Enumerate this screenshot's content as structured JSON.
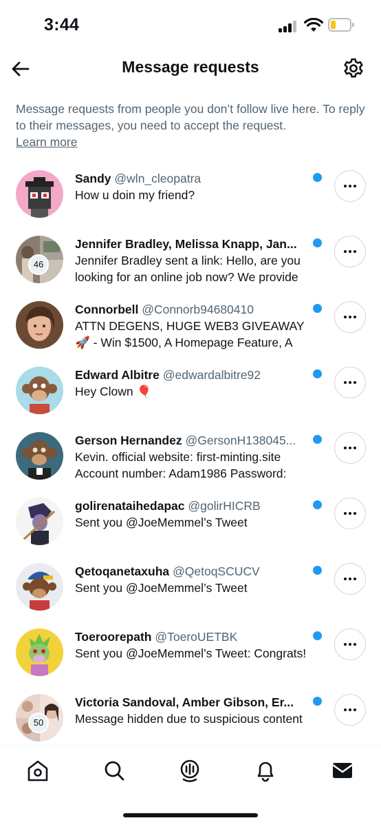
{
  "status_bar": {
    "time": "3:44",
    "battery_level": 0.25
  },
  "header": {
    "title": "Message requests"
  },
  "info": {
    "text": "Message requests from people you don’t follow live here. To reply to their messages, you need to accept the request.",
    "link": "Learn more"
  },
  "requests": [
    {
      "name": "Sandy",
      "handle": "@wln_cleopatra",
      "message": "How u doin my friend?",
      "message2": "",
      "unread": true
    },
    {
      "name": "Jennifer Bradley, Melissa Knapp, Jan...",
      "handle": "",
      "message": "Jennifer Bradley sent a link: Hello, are you",
      "message2": "looking for an online job now? We provide",
      "badge": "46",
      "unread": true
    },
    {
      "name": "Connorbell",
      "handle": "@Connorb94680410",
      "message": "ATTN DEGENS, HUGE WEB3 GIVEAWAY",
      "message2": "🚀 - Win $1500, A Homepage Feature, A",
      "unread": true
    },
    {
      "name": "Edward Albitre",
      "handle": "@edwardalbitre92",
      "message": "Hey Clown 🎈",
      "message2": "",
      "unread": true
    },
    {
      "name": "Gerson Hernandez",
      "handle": "@GersonH138045...",
      "message": "Kevin. official website: first-minting.site",
      "message2": "Account number: Adam1986 Password:",
      "unread": true
    },
    {
      "name": "golirenataihedapac",
      "handle": "@golirHICRB",
      "message": "Sent you @JoeMemmel’s Tweet",
      "message2": "",
      "unread": true
    },
    {
      "name": "Qetoqanetaxuha",
      "handle": "@QetoqSCUCV",
      "message": "Sent you @JoeMemmel’s Tweet",
      "message2": "",
      "unread": true
    },
    {
      "name": "Toeroorepath",
      "handle": "@ToeroUETBK",
      "message": "Sent you @JoeMemmel’s Tweet: Congrats!",
      "message2": "",
      "unread": true
    },
    {
      "name": "Victoria Sandoval, Amber Gibson, Er...",
      "handle": "",
      "message": "Message hidden due to suspicious content",
      "message2": "",
      "badge": "50",
      "unread": true
    }
  ],
  "tabs": [
    {
      "icon": "home-icon"
    },
    {
      "icon": "search-icon"
    },
    {
      "icon": "spaces-icon"
    },
    {
      "icon": "notifications-icon"
    },
    {
      "icon": "messages-icon"
    }
  ],
  "colors": {
    "accent": "#1d9bf0",
    "text": "#0f1419",
    "muted": "#536471"
  }
}
